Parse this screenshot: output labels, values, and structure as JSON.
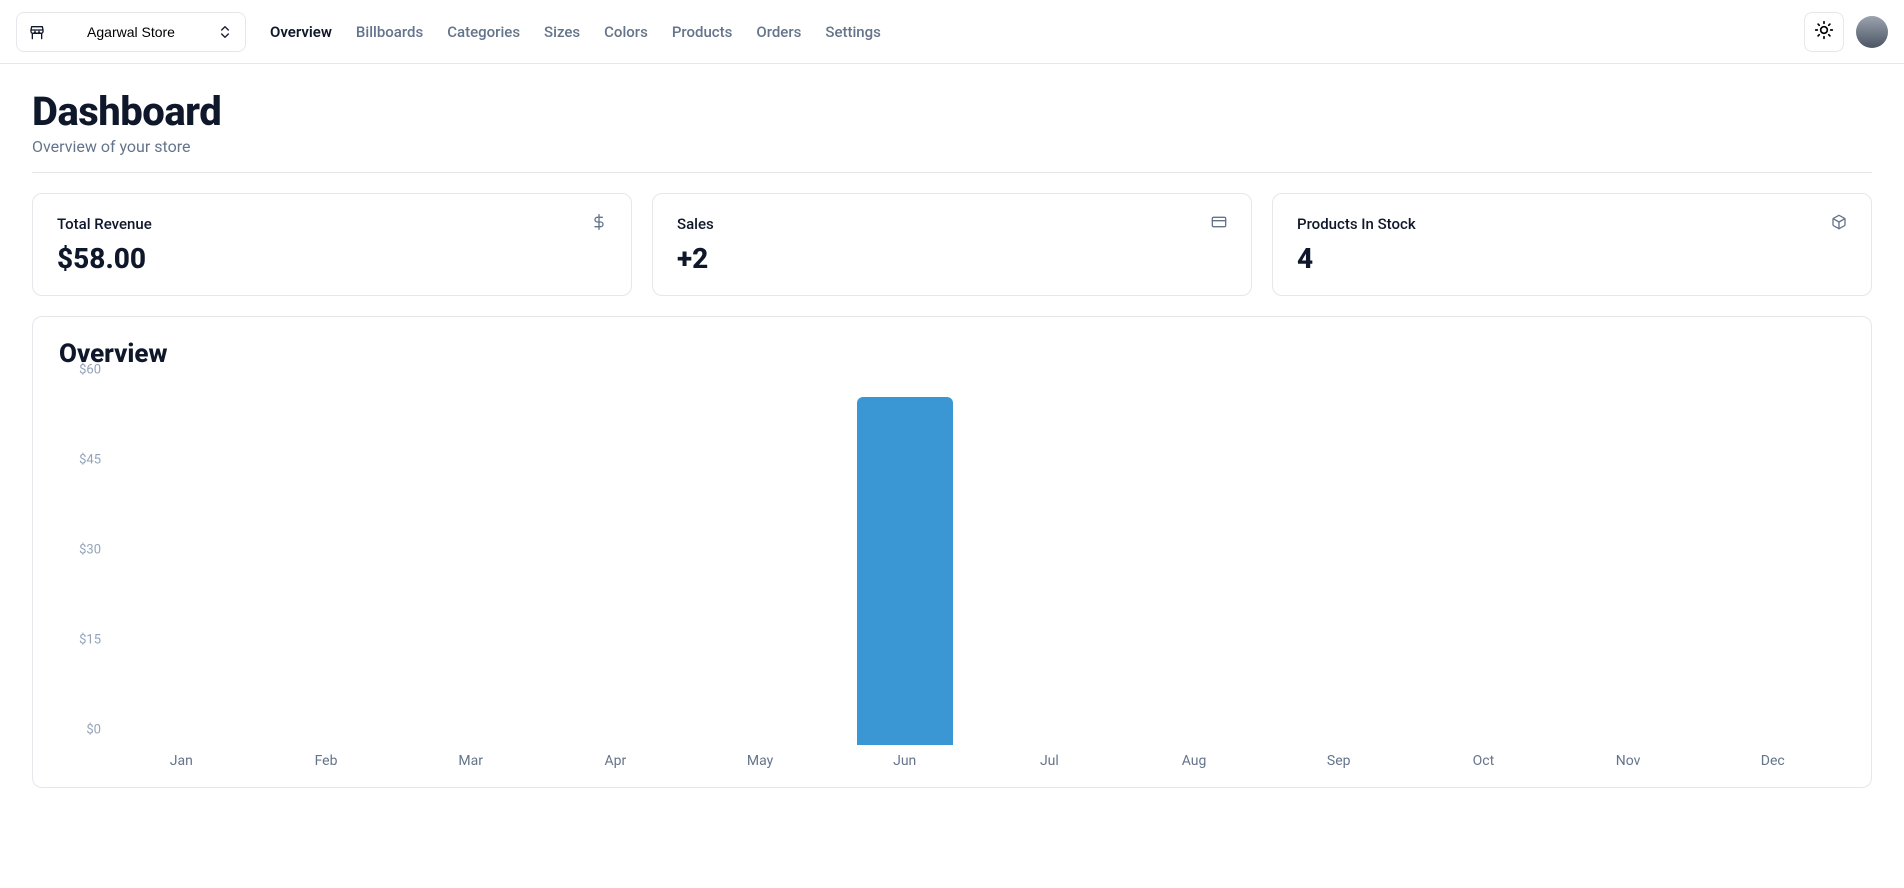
{
  "store_switcher": {
    "name": "Agarwal Store"
  },
  "nav": {
    "items": [
      {
        "label": "Overview",
        "active": true
      },
      {
        "label": "Billboards",
        "active": false
      },
      {
        "label": "Categories",
        "active": false
      },
      {
        "label": "Sizes",
        "active": false
      },
      {
        "label": "Colors",
        "active": false
      },
      {
        "label": "Products",
        "active": false
      },
      {
        "label": "Orders",
        "active": false
      },
      {
        "label": "Settings",
        "active": false
      }
    ]
  },
  "page": {
    "title": "Dashboard",
    "subtitle": "Overview of your store"
  },
  "stats": {
    "revenue": {
      "label": "Total Revenue",
      "value": "$58.00"
    },
    "sales": {
      "label": "Sales",
      "value": "+2"
    },
    "stock": {
      "label": "Products In Stock",
      "value": "4"
    }
  },
  "chart": {
    "title": "Overview"
  },
  "chart_data": {
    "type": "bar",
    "categories": [
      "Jan",
      "Feb",
      "Mar",
      "Apr",
      "May",
      "Jun",
      "Jul",
      "Aug",
      "Sep",
      "Oct",
      "Nov",
      "Dec"
    ],
    "values": [
      0,
      0,
      0,
      0,
      0,
      58,
      0,
      0,
      0,
      0,
      0,
      0
    ],
    "ylabel": "",
    "xlabel": "",
    "ylim": [
      0,
      60
    ],
    "y_ticks": [
      "$0",
      "$15",
      "$30",
      "$45",
      "$60"
    ],
    "bar_color": "#3b97d3"
  }
}
